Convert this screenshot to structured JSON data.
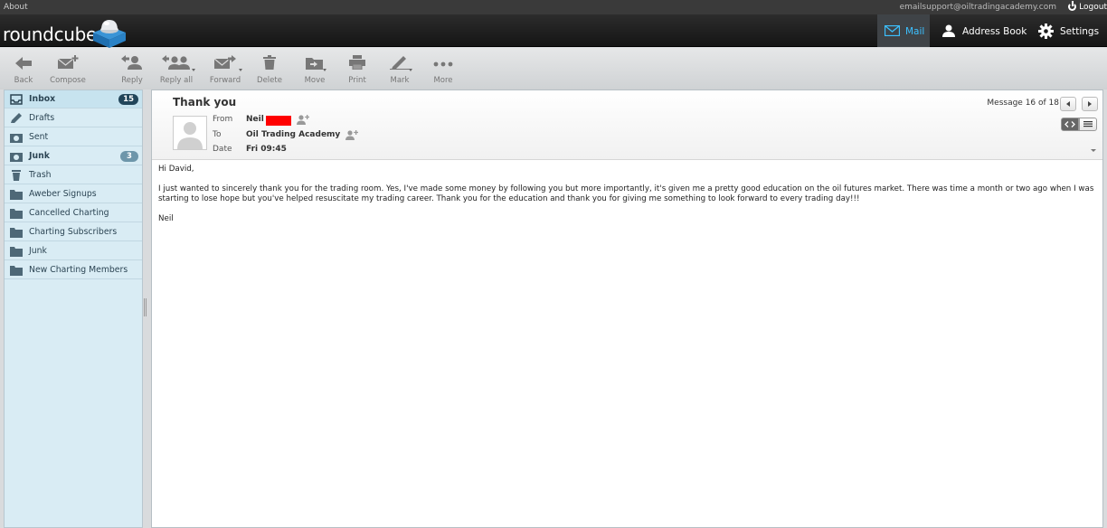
{
  "topline": {
    "about": "About",
    "user_email": "emailsupport@oiltradingacademy.com",
    "logout": "Logout"
  },
  "header": {
    "logo_text": "roundcube",
    "tasks": [
      {
        "label": "Mail",
        "icon": "mail-icon",
        "active": true
      },
      {
        "label": "Address Book",
        "icon": "person-icon",
        "active": false
      },
      {
        "label": "Settings",
        "icon": "gear-icon",
        "active": false
      }
    ]
  },
  "toolbar": {
    "buttons": [
      {
        "label": "Back",
        "icon": "back-arrow-icon"
      },
      {
        "label": "Compose",
        "icon": "compose-icon"
      },
      {
        "label": "Reply",
        "icon": "reply-icon"
      },
      {
        "label": "Reply all",
        "icon": "reply-all-icon"
      },
      {
        "label": "Forward",
        "icon": "forward-icon"
      },
      {
        "label": "Delete",
        "icon": "trash-icon"
      },
      {
        "label": "Move",
        "icon": "move-icon"
      },
      {
        "label": "Print",
        "icon": "print-icon"
      },
      {
        "label": "Mark",
        "icon": "mark-icon"
      },
      {
        "label": "More",
        "icon": "more-icon"
      }
    ]
  },
  "folders": [
    {
      "name": "Inbox",
      "icon": "inbox-icon",
      "count": "15",
      "bold": true,
      "selected": true
    },
    {
      "name": "Drafts",
      "icon": "pencil-icon"
    },
    {
      "name": "Sent",
      "icon": "sent-icon"
    },
    {
      "name": "Junk",
      "icon": "junk-icon",
      "count": "3",
      "bold": true
    },
    {
      "name": "Trash",
      "icon": "trash-icon"
    },
    {
      "name": "Aweber Signups",
      "icon": "folder-icon"
    },
    {
      "name": "Cancelled Charting",
      "icon": "folder-icon"
    },
    {
      "name": "Charting Subscribers",
      "icon": "folder-icon"
    },
    {
      "name": "Junk",
      "icon": "folder-icon"
    },
    {
      "name": "New Charting Members",
      "icon": "folder-icon"
    }
  ],
  "message": {
    "subject": "Thank you",
    "from_label": "From",
    "from_value": "Neil",
    "to_label": "To",
    "to_value": "Oil Trading Academy",
    "date_label": "Date",
    "date_value": "Fri 09:45",
    "counter": "Message 16 of 18",
    "body": [
      "Hi David,",
      "I just wanted to sincerely thank you for the trading room. Yes, I've made some money by following you but more importantly, it's given me a pretty good education on the oil futures market. There was time a month or two ago when I was starting to lose hope but you've helped resuscitate my trading career. Thank you for the education and thank you for giving me something to look forward to every trading day!!!",
      "Neil"
    ]
  },
  "colors": {
    "header_bg": "#1f1f1f",
    "active_task": "#3cc0ff",
    "folder_bg": "#d9ecf4",
    "badge_dark": "#21455a",
    "badge_light": "#6e96aa",
    "redaction": "#ff0000"
  }
}
